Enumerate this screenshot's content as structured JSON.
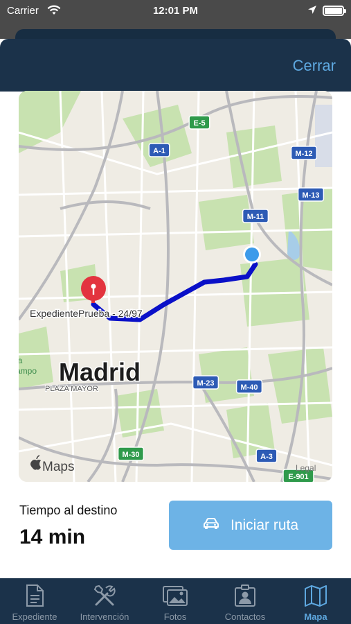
{
  "status_bar": {
    "carrier": "Carrier",
    "time": "12:01 PM"
  },
  "header": {
    "close_label": "Cerrar"
  },
  "map": {
    "city_label": "Madrid",
    "district_label": "PLAZA MAYOR",
    "destination_label": "ExpedientePrueba - 24/97",
    "attribution": "Maps",
    "legal_label": "Legal",
    "edge_labels": [
      "la",
      "ampo"
    ],
    "road_shields": [
      {
        "text": "E-5",
        "kind": "green"
      },
      {
        "text": "A-1",
        "kind": "blue"
      },
      {
        "text": "M-12",
        "kind": "blue"
      },
      {
        "text": "M-13",
        "kind": "blue"
      },
      {
        "text": "M-11",
        "kind": "blue"
      },
      {
        "text": "M-23",
        "kind": "blue"
      },
      {
        "text": "M-40",
        "kind": "blue"
      },
      {
        "text": "M-30",
        "kind": "green"
      },
      {
        "text": "A-3",
        "kind": "blue"
      },
      {
        "text": "E-901",
        "kind": "green"
      }
    ],
    "route_color": "#0a10c8",
    "pin_color": "#e3343f",
    "current_location_color": "#3d9bea"
  },
  "eta": {
    "label": "Tiempo al destino",
    "value": "14 min"
  },
  "actions": {
    "start_route_label": "Iniciar ruta"
  },
  "tabs": [
    {
      "label": "Expediente",
      "icon": "document-icon"
    },
    {
      "label": "Intervención",
      "icon": "tools-icon"
    },
    {
      "label": "Fotos",
      "icon": "photos-icon"
    },
    {
      "label": "Contactos",
      "icon": "contact-card-icon"
    },
    {
      "label": "Mapa",
      "icon": "map-icon",
      "active": true
    }
  ],
  "colors": {
    "navy": "#1b324a",
    "accent": "#5ea8e0",
    "button": "#6db3e6"
  }
}
